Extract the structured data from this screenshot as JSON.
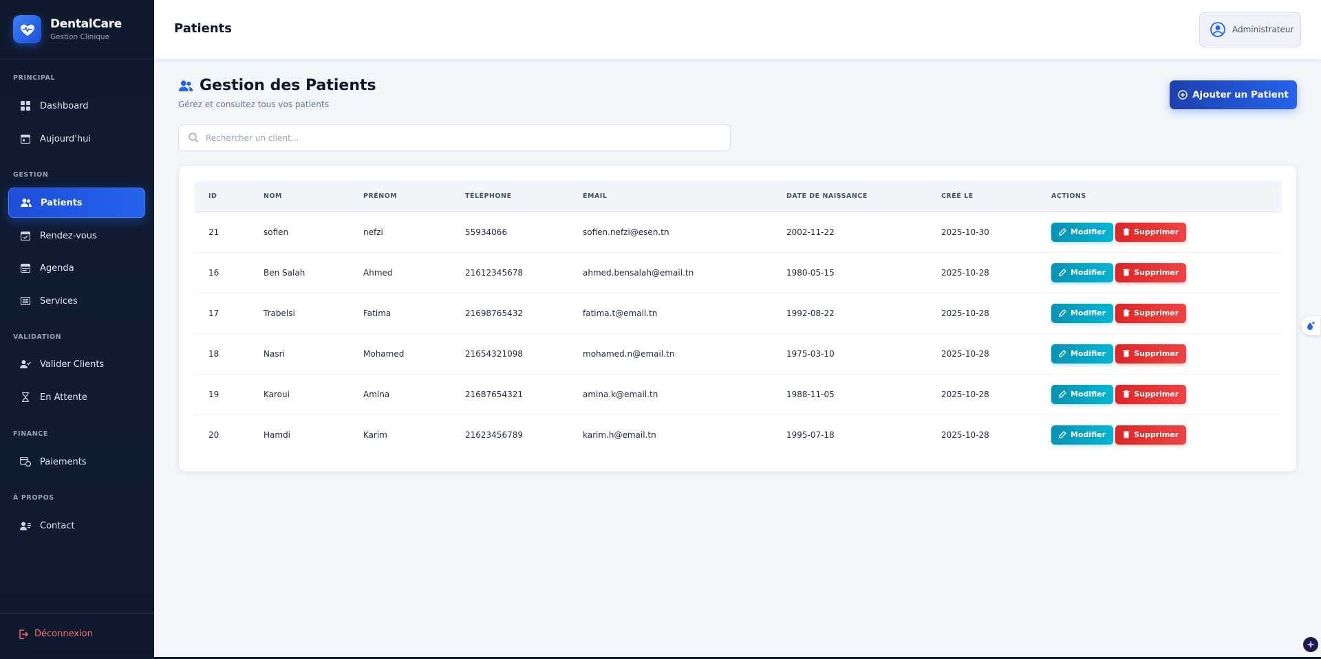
{
  "brand": {
    "name": "DentalCare",
    "subtitle": "Gestion Clinique"
  },
  "sidebar": {
    "sections": [
      {
        "title": "PRINCIPAL"
      },
      {
        "title": "GESTION"
      },
      {
        "title": "VALIDATION"
      },
      {
        "title": "FINANCE"
      },
      {
        "title": "À PROPOS"
      }
    ],
    "items": [
      {
        "label": "Dashboard",
        "icon": "grid-icon"
      },
      {
        "label": "Aujourd'hui",
        "icon": "calendar-day-icon"
      },
      {
        "label": "Patients",
        "icon": "users-icon",
        "active": true
      },
      {
        "label": "Rendez-vous",
        "icon": "calendar-check-icon"
      },
      {
        "label": "Agenda",
        "icon": "calendar-week-icon"
      },
      {
        "label": "Services",
        "icon": "list-icon"
      },
      {
        "label": "Valider Clients",
        "icon": "user-check-icon"
      },
      {
        "label": "En Attente",
        "icon": "hourglass-icon"
      },
      {
        "label": "Paiements",
        "icon": "payment-icon"
      },
      {
        "label": "Contact",
        "icon": "contact-icon"
      }
    ],
    "logout_label": "Déconnexion"
  },
  "topbar": {
    "title": "Patients",
    "user_label": "Administrateur"
  },
  "main": {
    "title": "Gestion des Patients",
    "subtitle": "Gérez et consultez tous vos patients",
    "add_button_label": "Ajouter un Patient",
    "search_placeholder": "Rechercher un client..."
  },
  "table": {
    "columns": [
      "ID",
      "NOM",
      "PRÉNOM",
      "TÉLÉPHONE",
      "EMAIL",
      "DATE DE NAISSANCE",
      "CRÉÉ LE",
      "ACTIONS"
    ],
    "edit_label": "Modifier",
    "delete_label": "Supprimer",
    "rows": [
      [
        "21",
        "sofien",
        "nefzi",
        "55934066",
        "sofien.nefzi@esen.tn",
        "2002-11-22",
        "2025-10-30"
      ],
      [
        "16",
        "Ben Salah",
        "Ahmed",
        "21612345678",
        "ahmed.bensalah@email.tn",
        "1980-05-15",
        "2025-10-28"
      ],
      [
        "17",
        "Trabelsi",
        "Fatima",
        "21698765432",
        "fatima.t@email.tn",
        "1992-08-22",
        "2025-10-28"
      ],
      [
        "18",
        "Nasri",
        "Mohamed",
        "21654321098",
        "mohamed.n@email.tn",
        "1975-03-10",
        "2025-10-28"
      ],
      [
        "19",
        "Karoui",
        "Amina",
        "21687654321",
        "amina.k@email.tn",
        "1988-11-05",
        "2025-10-28"
      ],
      [
        "20",
        "Hamdi",
        "Karim",
        "21623456789",
        "karim.h@email.tn",
        "1995-07-18",
        "2025-10-28"
      ]
    ]
  },
  "colors": {
    "accent": "#2563eb",
    "edit": "#06b6d4",
    "delete": "#ef4444",
    "sidebar_bg": "#0f1a2e"
  }
}
